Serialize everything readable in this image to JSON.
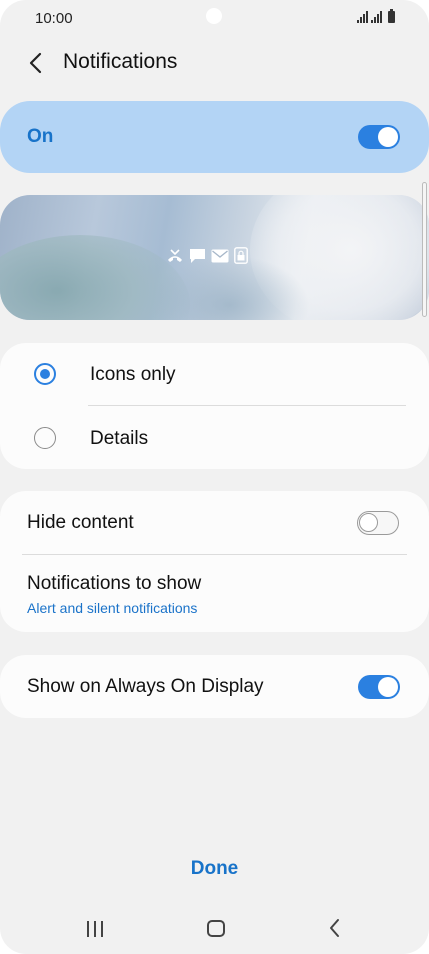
{
  "status_bar": {
    "time": "10:00"
  },
  "header": {
    "title": "Notifications"
  },
  "master_switch": {
    "label": "On",
    "enabled": true
  },
  "preview": {
    "icons": [
      "missed-call-icon",
      "message-icon",
      "email-icon",
      "lock-icon"
    ]
  },
  "style_options": [
    {
      "label": "Icons only",
      "selected": true
    },
    {
      "label": "Details",
      "selected": false
    }
  ],
  "settings": {
    "hide_content": {
      "label": "Hide content",
      "enabled": false
    },
    "notifications_to_show": {
      "label": "Notifications to show",
      "value": "Alert and silent notifications"
    }
  },
  "aod": {
    "label": "Show on Always On Display",
    "enabled": true
  },
  "footer": {
    "done_label": "Done"
  },
  "colors": {
    "accent": "#2b80e0",
    "accent_text": "#1873c9",
    "on_card": "#b3d4f5",
    "background": "#f1f1f1"
  }
}
